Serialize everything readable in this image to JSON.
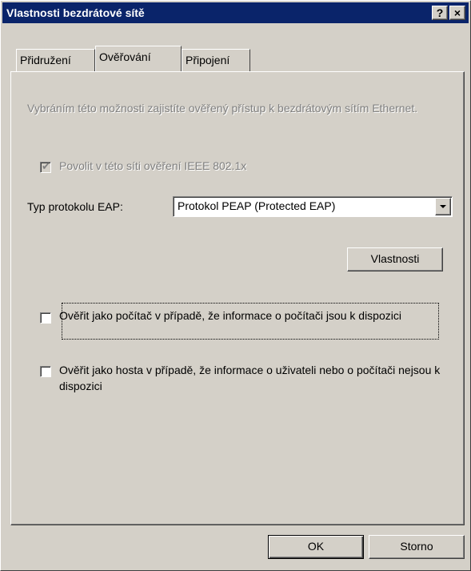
{
  "window": {
    "title": "Vlastnosti bezdrátové sítě",
    "help_button": "?",
    "close_button": "×"
  },
  "tabs": [
    {
      "label": "Přidružení",
      "active": false
    },
    {
      "label": "Ověřování",
      "active": true
    },
    {
      "label": "Připojení",
      "active": false
    }
  ],
  "panel": {
    "description": "Vybráním této možnosti zajistíte ověřený přístup k bezdrátovým sítím Ethernet.",
    "enable_8021x": {
      "label": "Povolit v této síti ověření IEEE 802.1x",
      "checked": true,
      "enabled": false
    },
    "eap_type": {
      "label": "Typ protokolu EAP:",
      "value": "Protokol PEAP (Protected EAP)"
    },
    "properties_button": "Vlastnosti",
    "auth_as_computer": {
      "label": "Ověřit jako počítač v případě, že informace o počítači jsou k dispozici",
      "checked": false
    },
    "auth_as_guest": {
      "label": "Ověřit jako hosta v případě, že informace o uživateli nebo o počítači nejsou k dispozici",
      "checked": false
    }
  },
  "footer": {
    "ok_button": "OK",
    "cancel_button": "Storno"
  }
}
